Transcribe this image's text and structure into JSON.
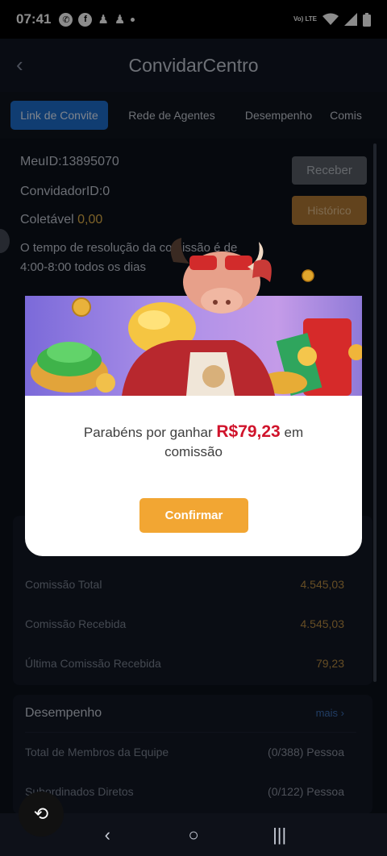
{
  "status": {
    "time": "07:41",
    "icons": [
      "whatsapp-icon",
      "facebook-icon",
      "person-icon",
      "person-icon"
    ],
    "network": "Vo) LTE"
  },
  "appbar": {
    "title": "ConvidarCentro"
  },
  "tabs": [
    {
      "label": "Link de Convite"
    },
    {
      "label": "Rede de Agentes"
    },
    {
      "label": "Desempenho"
    },
    {
      "label": "Comis"
    }
  ],
  "info": {
    "meu_id": "MeuID:13895070",
    "convidador_id": "ConvidadorID:0",
    "coletavel_label": "Coletável",
    "coletavel_value": "0,00",
    "note_line1": "O tempo de resolução da comissão é de",
    "note_line2": "4:00-8:00 todos os dias"
  },
  "buttons": {
    "receber": "Receber",
    "historico": "Histórico"
  },
  "commission": {
    "rows": [
      {
        "label": "Comissão Total",
        "value": "4.545,03"
      },
      {
        "label": "Comissão Recebida",
        "value": "4.545,03"
      },
      {
        "label": "Última Comissão Recebida",
        "value": "79,23"
      }
    ]
  },
  "performance": {
    "title": "Desempenho",
    "mais": "mais",
    "rows": [
      {
        "label": "Total de Membros da Equipe",
        "value": "(0/388) Pessoa"
      },
      {
        "label": "Subordinados Diretos",
        "value": "(0/122) Pessoa"
      }
    ]
  },
  "modal": {
    "msg_prefix": "Parabéns por ganhar",
    "amount": "R$79,23",
    "msg_suffix": "em",
    "msg_line2": "comissão",
    "confirm": "Confirmar"
  },
  "colors": {
    "accent": "#1e6fd0",
    "gold": "#e4b24a",
    "confirm": "#f2a633",
    "amount": "#d0132b"
  }
}
